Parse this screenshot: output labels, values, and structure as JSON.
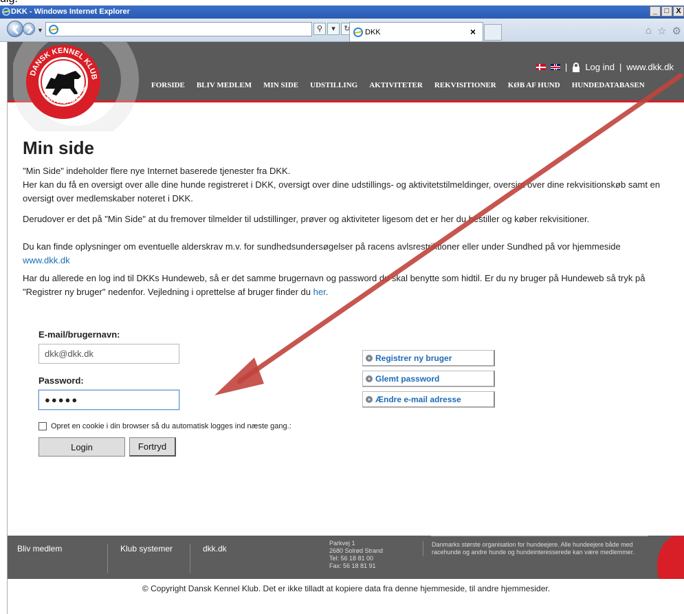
{
  "top_crop_text": "dig.",
  "window": {
    "title": "DKK - Windows Internet Explorer",
    "controls": [
      "_",
      "□",
      "X"
    ]
  },
  "browser": {
    "address_value": "",
    "tab_title": "DKK",
    "tab_close": "×"
  },
  "header": {
    "login_label": "Log ind",
    "separator": "|",
    "site_link": "www.dkk.dk",
    "logo_top": "DANSK KENNEL KLUB",
    "logo_bottom": "FOR HUNDEEJERE",
    "nav": [
      "FORSIDE",
      "BLIV MEDLEM",
      "MIN SIDE",
      "UDSTILLING",
      "AKTIVITETER",
      "REKVISITIONER",
      "KØB AF HUND",
      "HUNDEDATABASEN"
    ]
  },
  "content": {
    "title": "Min side",
    "p1a": "\"Min Side\" indeholder flere nye Internet baserede tjenester fra DKK.",
    "p1b": "Her kan du få en oversigt over alle dine hunde registreret i DKK, oversigt over dine udstillings- og aktivitetstilmeldinger, oversigt over dine rekvisitionskøb samt en oversigt over medlemskaber noteret i DKK.",
    "p2": "Derudover er det på \"Min Side\" at du fremover tilmelder til udstillinger, prøver og aktiviteter ligesom det er her du bestiller og køber rekvisitioner.",
    "p3": "Du kan finde oplysninger om eventuelle alderskrav m.v. for sundhedsundersøgelser på racens avlsrestriktioner eller under Sundhed på vor hjemmeside",
    "p3_link": "www.dkk.dk",
    "p4a": "Har du allerede en log ind til DKKs Hundeweb, så er det samme brugernavn og password du skal benytte som hidtil. Er du ny bruger på Hundeweb så tryk på \"Registrer ny bruger\" nedenfor. Vejledning i oprettelse af bruger finder du",
    "p4_link": "her",
    "p4_end": "."
  },
  "login": {
    "email_label": "E-mail/brugernavn:",
    "email_value": "dkk@dkk.dk",
    "password_label": "Password:",
    "password_value": "●●●●●",
    "cookie_label": "Opret en cookie i din browser så du automatisk logges ind næste gang.:",
    "login_button": "Login",
    "cancel_button": "Fortryd"
  },
  "side_buttons": [
    "Registrer ny bruger",
    "Glemt password",
    "Ændre e-mail adresse"
  ],
  "footer": {
    "link1": "Bliv medlem",
    "link2": "Klub systemer",
    "link3": "dkk.dk",
    "address_street": "Parkvej 1",
    "address_city": "2680 Solrød Strand",
    "phone": "Tel:   56 18 81 00",
    "fax": "Fax:  56 18 81 91",
    "description": "Danmarks største organisation for hundeejere. Alle hundeejere både med racehunde og andre hunde og hundeinteresserede kan være medlemmer."
  },
  "copyright": "© Copyright Dansk Kennel Klub. Det er ikke tilladt at kopiere data fra denne hjemmeside, til andre hjemmesider.",
  "colors": {
    "header_bg": "#5a5a5a",
    "accent_red": "#d81e26",
    "link_blue": "#1a6fb3",
    "annotation_arrow": "#c0443c"
  }
}
